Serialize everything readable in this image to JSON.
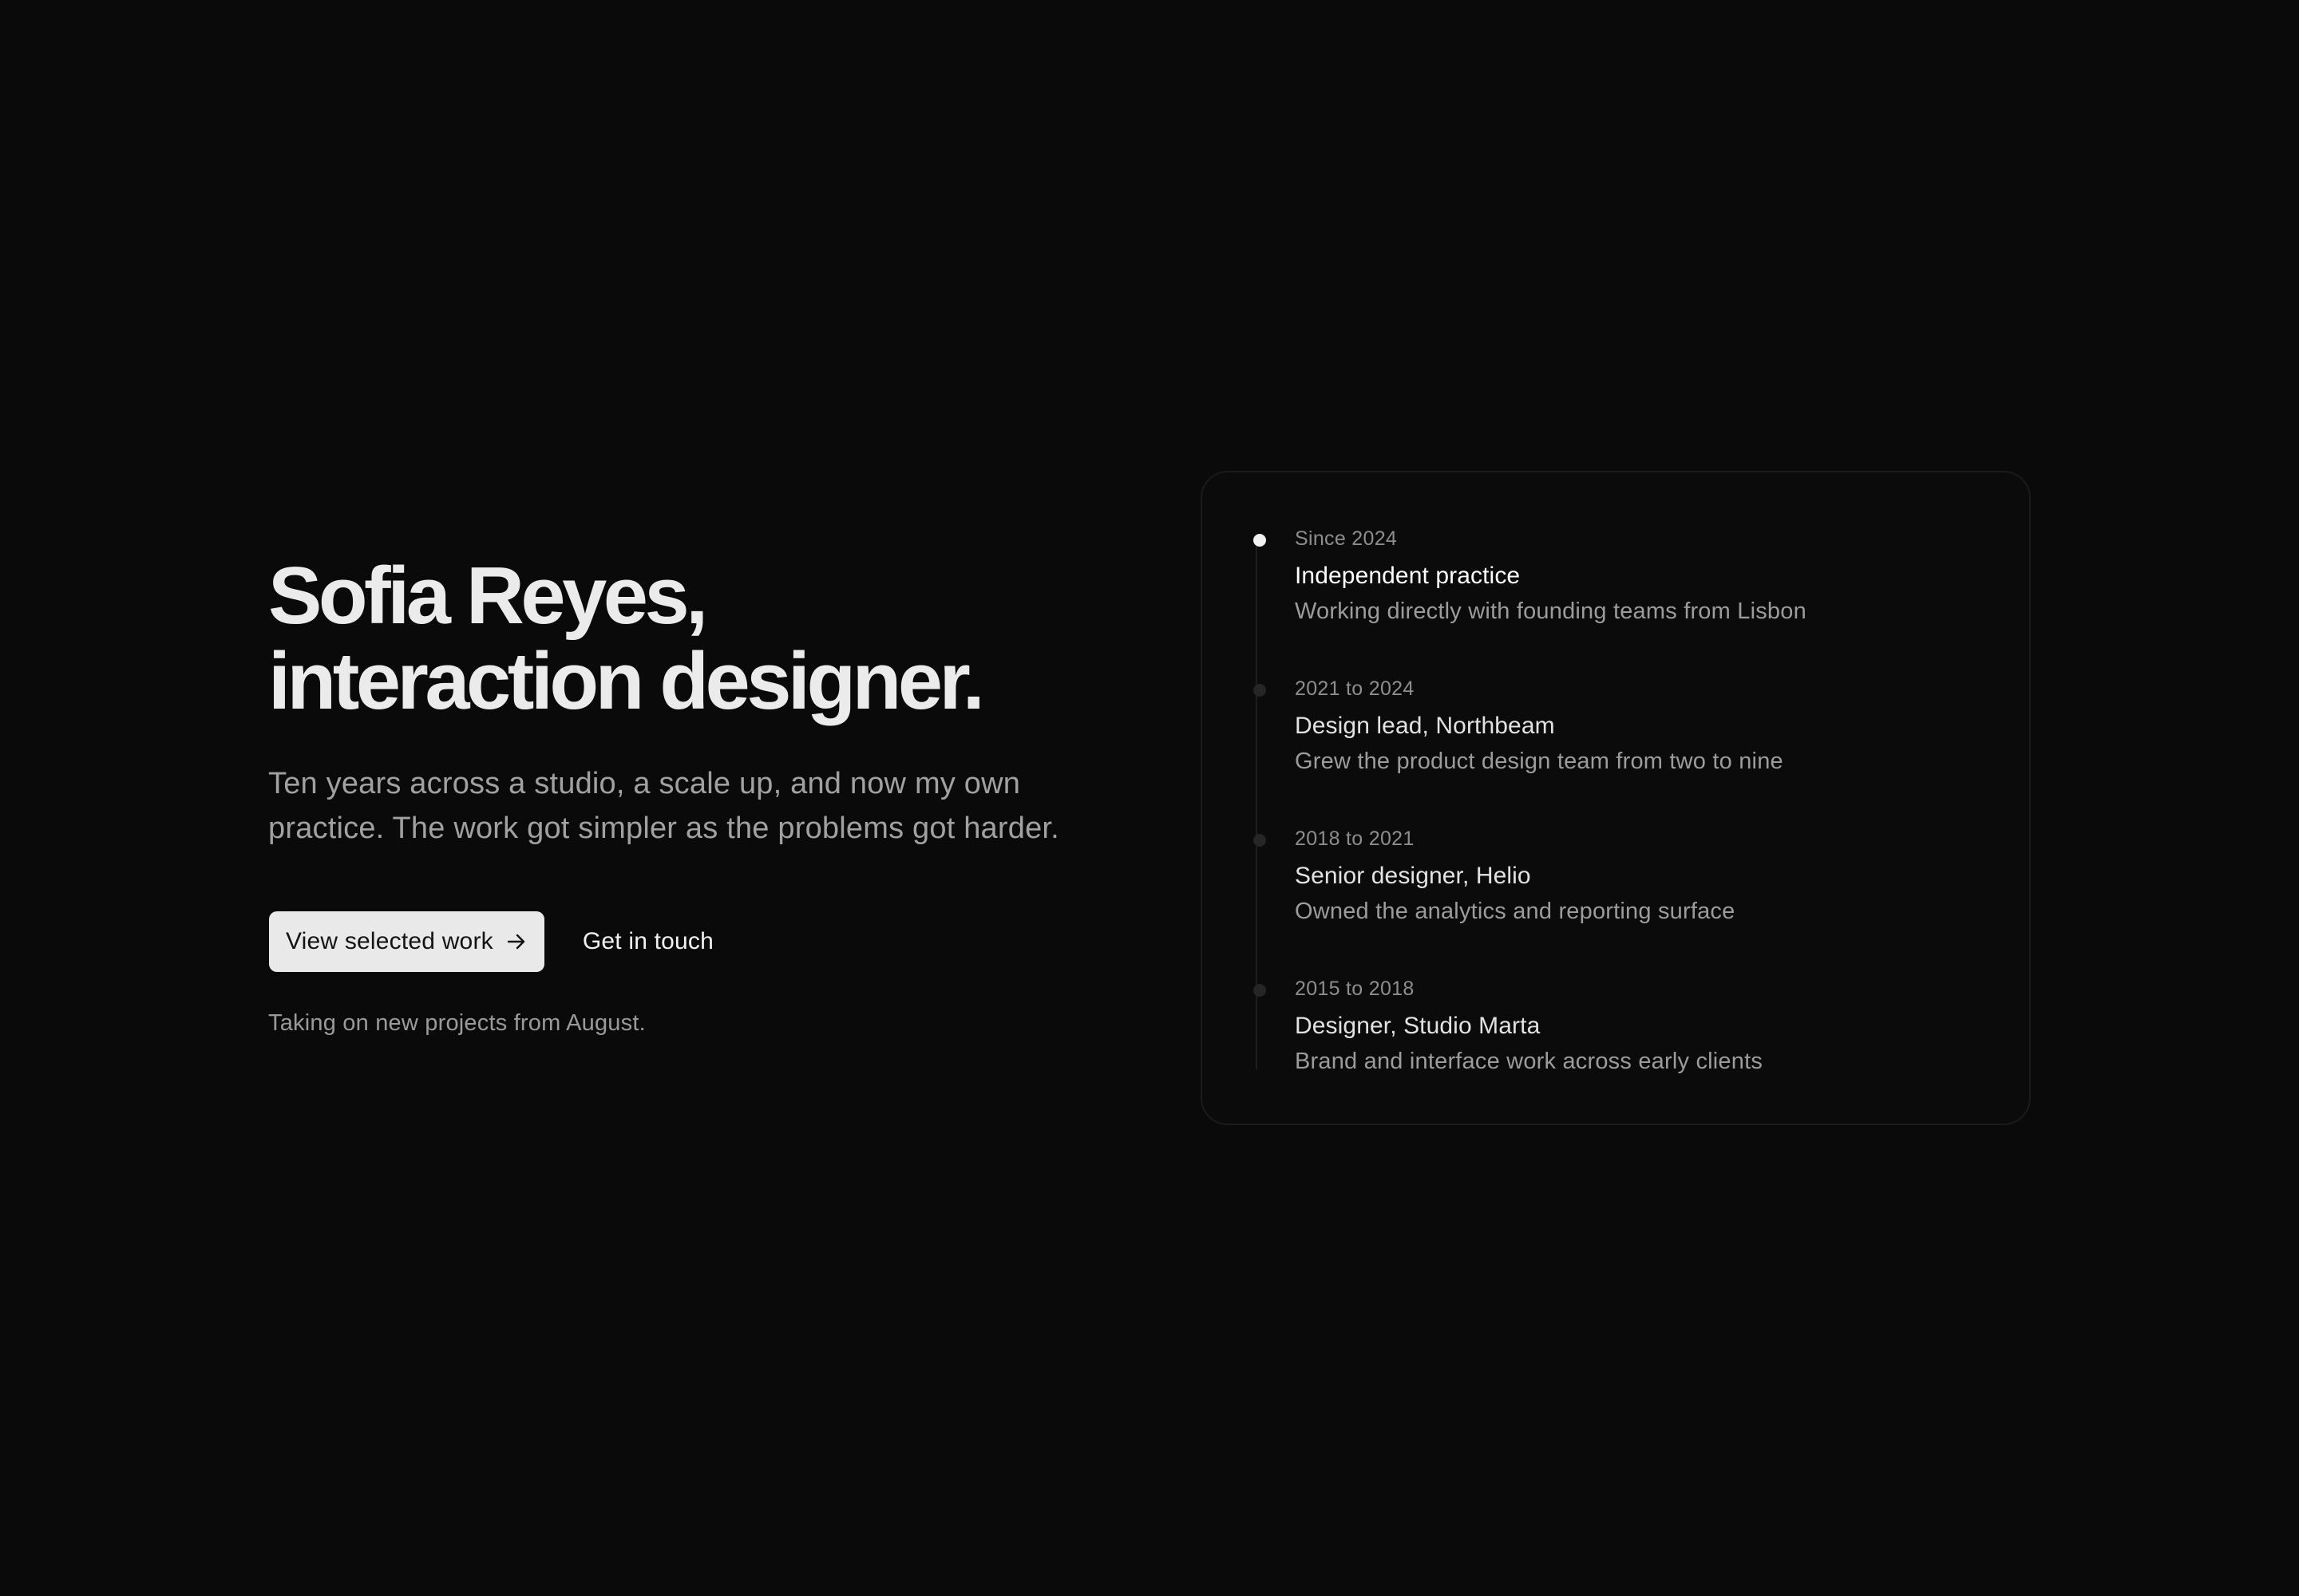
{
  "hero": {
    "title_line1": "Sofia Reyes,",
    "title_line2": "interaction designer.",
    "lede_line1": "Ten years across a studio, a scale up, and now my own",
    "lede_line2": "practice. The work got simpler as the problems got harder.",
    "primary_cta": "View selected work",
    "primary_cta_icon": "arrow-right-icon",
    "secondary_cta": "Get in touch",
    "availability": "Taking on new projects from August."
  },
  "timeline": {
    "entries": [
      {
        "date": "Since 2024",
        "role": "Independent practice",
        "description": "Working directly with founding teams from Lisbon",
        "current": true
      },
      {
        "date": "2021 to 2024",
        "role": "Design lead, Northbeam",
        "description": "Grew the product design team from two to nine",
        "current": false
      },
      {
        "date": "2018 to 2021",
        "role": "Senior designer, Helio",
        "description": "Owned the analytics and reporting surface",
        "current": false
      },
      {
        "date": "2015 to 2018",
        "role": "Designer, Studio Marta",
        "description": "Brand and interface work across early clients",
        "current": false
      }
    ]
  },
  "colors": {
    "background": "#0a0a0a",
    "card_border": "#1b1b1b",
    "primary_button_bg": "#e9e9e9",
    "active_dot": "#f2f2f2",
    "inactive_dot": "#262626"
  }
}
